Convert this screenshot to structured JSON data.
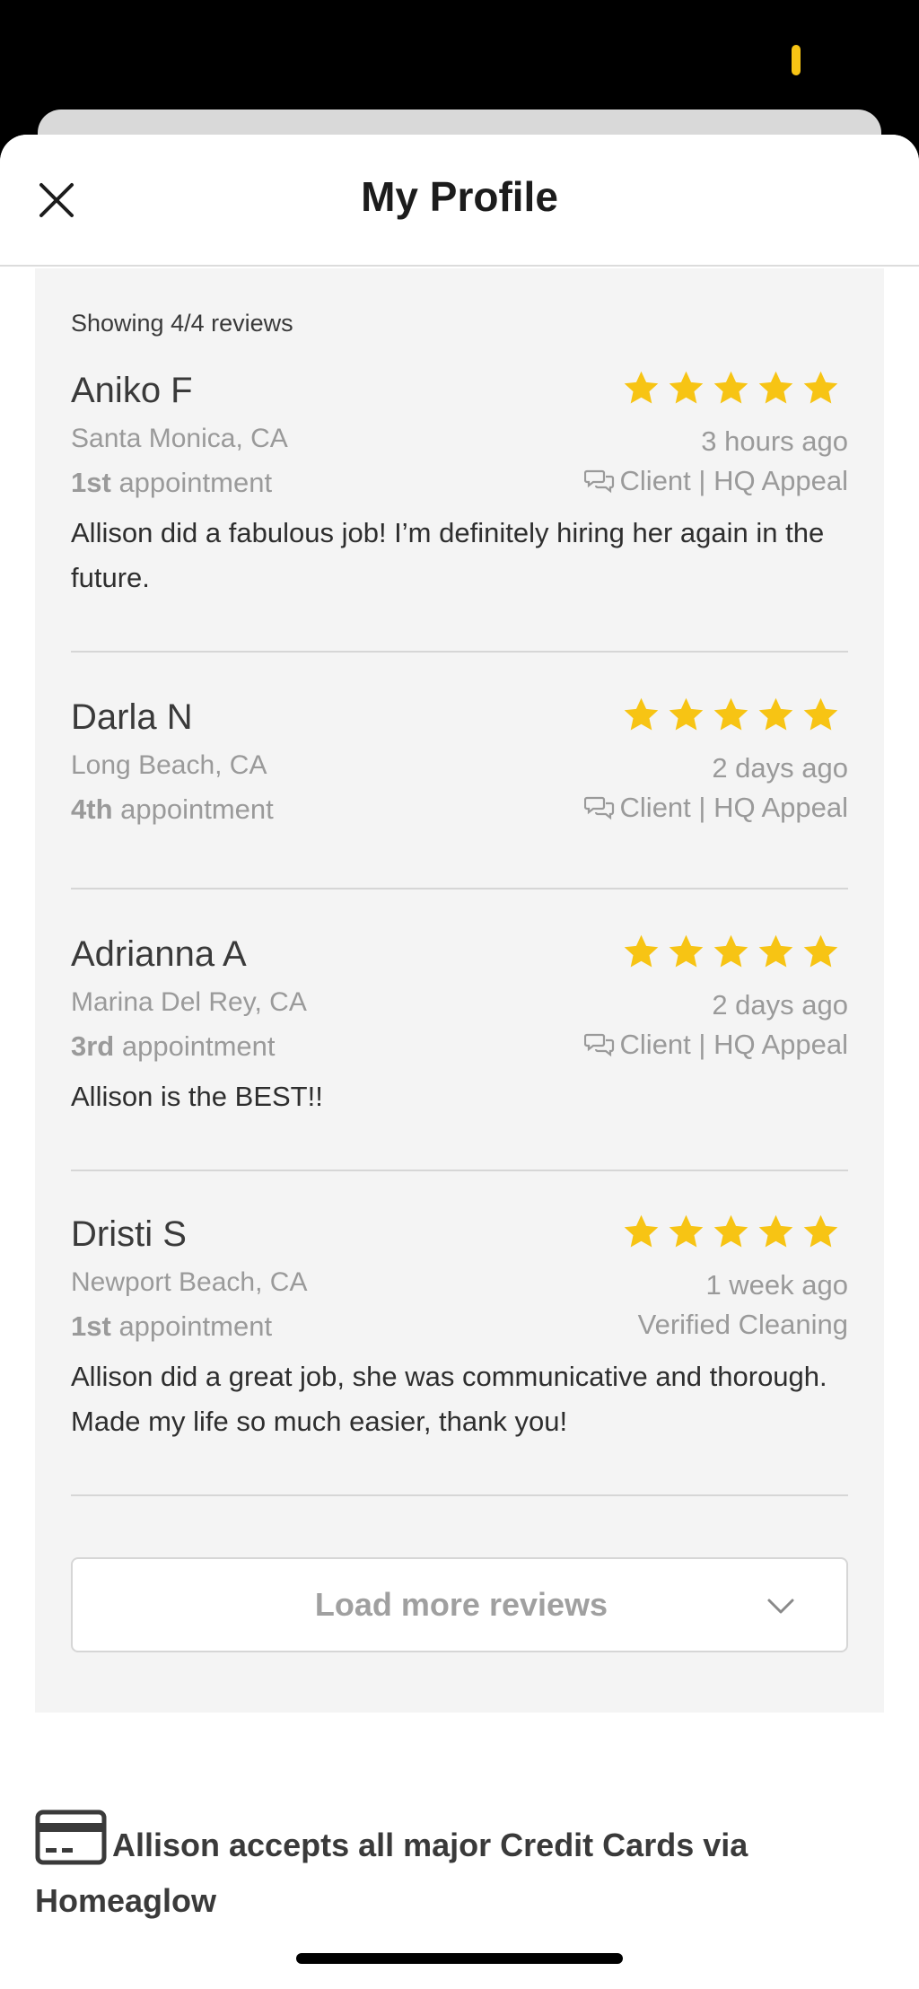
{
  "header": {
    "title": "My Profile",
    "close_icon": "close-icon"
  },
  "reviews": {
    "showing_text": "Showing 4/4 reviews",
    "rating_color": "#F7C414",
    "items": [
      {
        "name": "Aniko F",
        "city": "Santa Monica, CA",
        "appt_ordinal": "1st",
        "appt_label": "appointment",
        "rating": 5,
        "time_ago": "3 hours ago",
        "source": "Client | HQ Appeal",
        "source_icon": "chat-bubbles-icon",
        "text": "Allison did a fabulous job! I’m definitely hiring her again in the future."
      },
      {
        "name": "Darla N",
        "city": "Long Beach, CA",
        "appt_ordinal": "4th",
        "appt_label": "appointment",
        "rating": 5,
        "time_ago": "2 days ago",
        "source": "Client | HQ Appeal",
        "source_icon": "chat-bubbles-icon",
        "text": ""
      },
      {
        "name": "Adrianna A",
        "city": "Marina Del Rey, CA",
        "appt_ordinal": "3rd",
        "appt_label": "appointment",
        "rating": 5,
        "time_ago": "2 days ago",
        "source": "Client | HQ Appeal",
        "source_icon": "chat-bubbles-icon",
        "text": "Allison is the BEST!!"
      },
      {
        "name": "Dristi S",
        "city": "Newport Beach, CA",
        "appt_ordinal": "1st",
        "appt_label": "appointment",
        "rating": 5,
        "time_ago": "1 week ago",
        "source": "Verified Cleaning",
        "source_icon": "",
        "text": "Allison did a great job, she was communicative and thorough. Made my life so much easier, thank you!"
      }
    ],
    "load_more_label": "Load more reviews",
    "load_more_icon": "chevron-down-icon"
  },
  "payment": {
    "icon": "credit-card-icon",
    "text": "Allison accepts all major Credit Cards via Homeaglow"
  }
}
